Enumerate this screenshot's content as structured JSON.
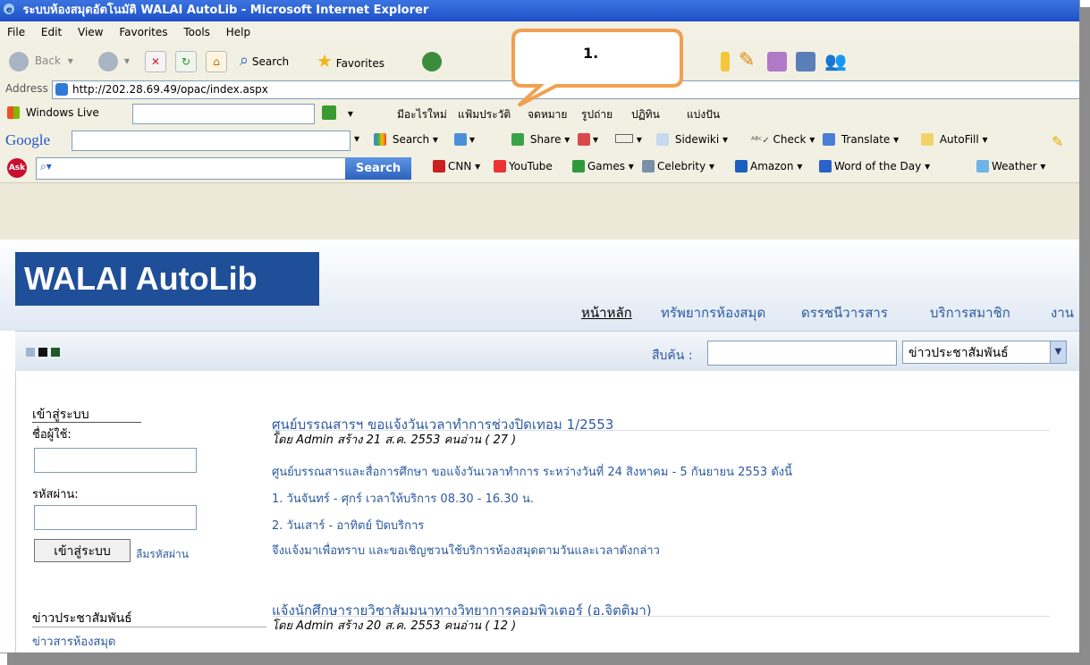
{
  "window": {
    "title": "ระบบห้องสมุดอัตโนมัติ WALAI AutoLib - Microsoft Internet Explorer"
  },
  "menu": [
    "File",
    "Edit",
    "View",
    "Favorites",
    "Tools",
    "Help"
  ],
  "toolbar": {
    "back": "Back",
    "search": "Search",
    "favorites": "Favorites"
  },
  "callout": {
    "label": "1."
  },
  "address": {
    "label": "Address",
    "url": "http://202.28.69.49/opac/index.aspx"
  },
  "windows_live": {
    "label": "Windows Live",
    "links": [
      "มีอะไรใหม่",
      "แฟ้มประวัติ",
      "จดหมาย",
      "รูปถ่าย",
      "ปฏิทิน",
      "แบ่งปัน"
    ]
  },
  "google": {
    "logo": "Google",
    "items": [
      "Search",
      "Share",
      "Sidewiki",
      "Check",
      "Translate",
      "AutoFill"
    ]
  },
  "ask": {
    "logo": "Ask",
    "search_button": "Search",
    "links": [
      "CNN",
      "YouTube",
      "Games",
      "Celebrity",
      "Amazon",
      "Word of the Day",
      "Weather"
    ]
  },
  "site": {
    "logo": "WALAI AutoLib",
    "nav": [
      "หน้าหลัก",
      "ทรัพยากรห้องสมุด",
      "ดรรชนีวารสาร",
      "บริการสมาชิก",
      "งาน"
    ],
    "search_label": "สืบค้น :",
    "search_select": "ข่าวประชาสัมพันธ์",
    "swatches": [
      "#9fb6cf",
      "#111111",
      "#1e5a2a"
    ]
  },
  "login": {
    "heading": "เข้าสู่ระบบ",
    "user_label": "ชื่อผู้ใช้:",
    "pass_label": "รหัสผ่าน:",
    "button": "เข้าสู่ระบบ",
    "forgot": "ลืมรหัสผ่าน"
  },
  "sidebar": {
    "news_heading": "ข่าวประชาสัมพันธ์",
    "news_link": "ข่าวสารห้องสมุด"
  },
  "news": [
    {
      "title": "ศูนย์บรรณสารฯ ขอแจ้งวันเวลาทำการช่วงปิดเทอม 1/2553",
      "meta": "โดย Admin สร้าง 21 ส.ค. 2553 คนอ่าน ( 27 )",
      "lines": [
        "ศูนย์บรรณสารและสื่อการศึกษา ขอแจ้งวันเวลาทำการ ระหว่างวันที่ 24 สิงหาคม - 5 กันยายน 2553 ดังนี้",
        "1. วันจันทร์ - ศุกร์ เวลาให้บริการ 08.30 - 16.30 น.",
        "2. วันเสาร์ - อาทิตย์ ปิดบริการ",
        "จึงแจ้งมาเพื่อทราบ และขอเชิญชวนใช้บริการห้องสมุดตามวันและเวลาดังกล่าว"
      ]
    },
    {
      "title": "แจ้งนักศึกษารายวิชาสัมมนาทางวิทยาการคอมพิวเตอร์ (อ.จิตติมา)",
      "meta": "โดย Admin สร้าง 20 ส.ค. 2553 คนอ่าน ( 12 )",
      "lines": []
    }
  ]
}
